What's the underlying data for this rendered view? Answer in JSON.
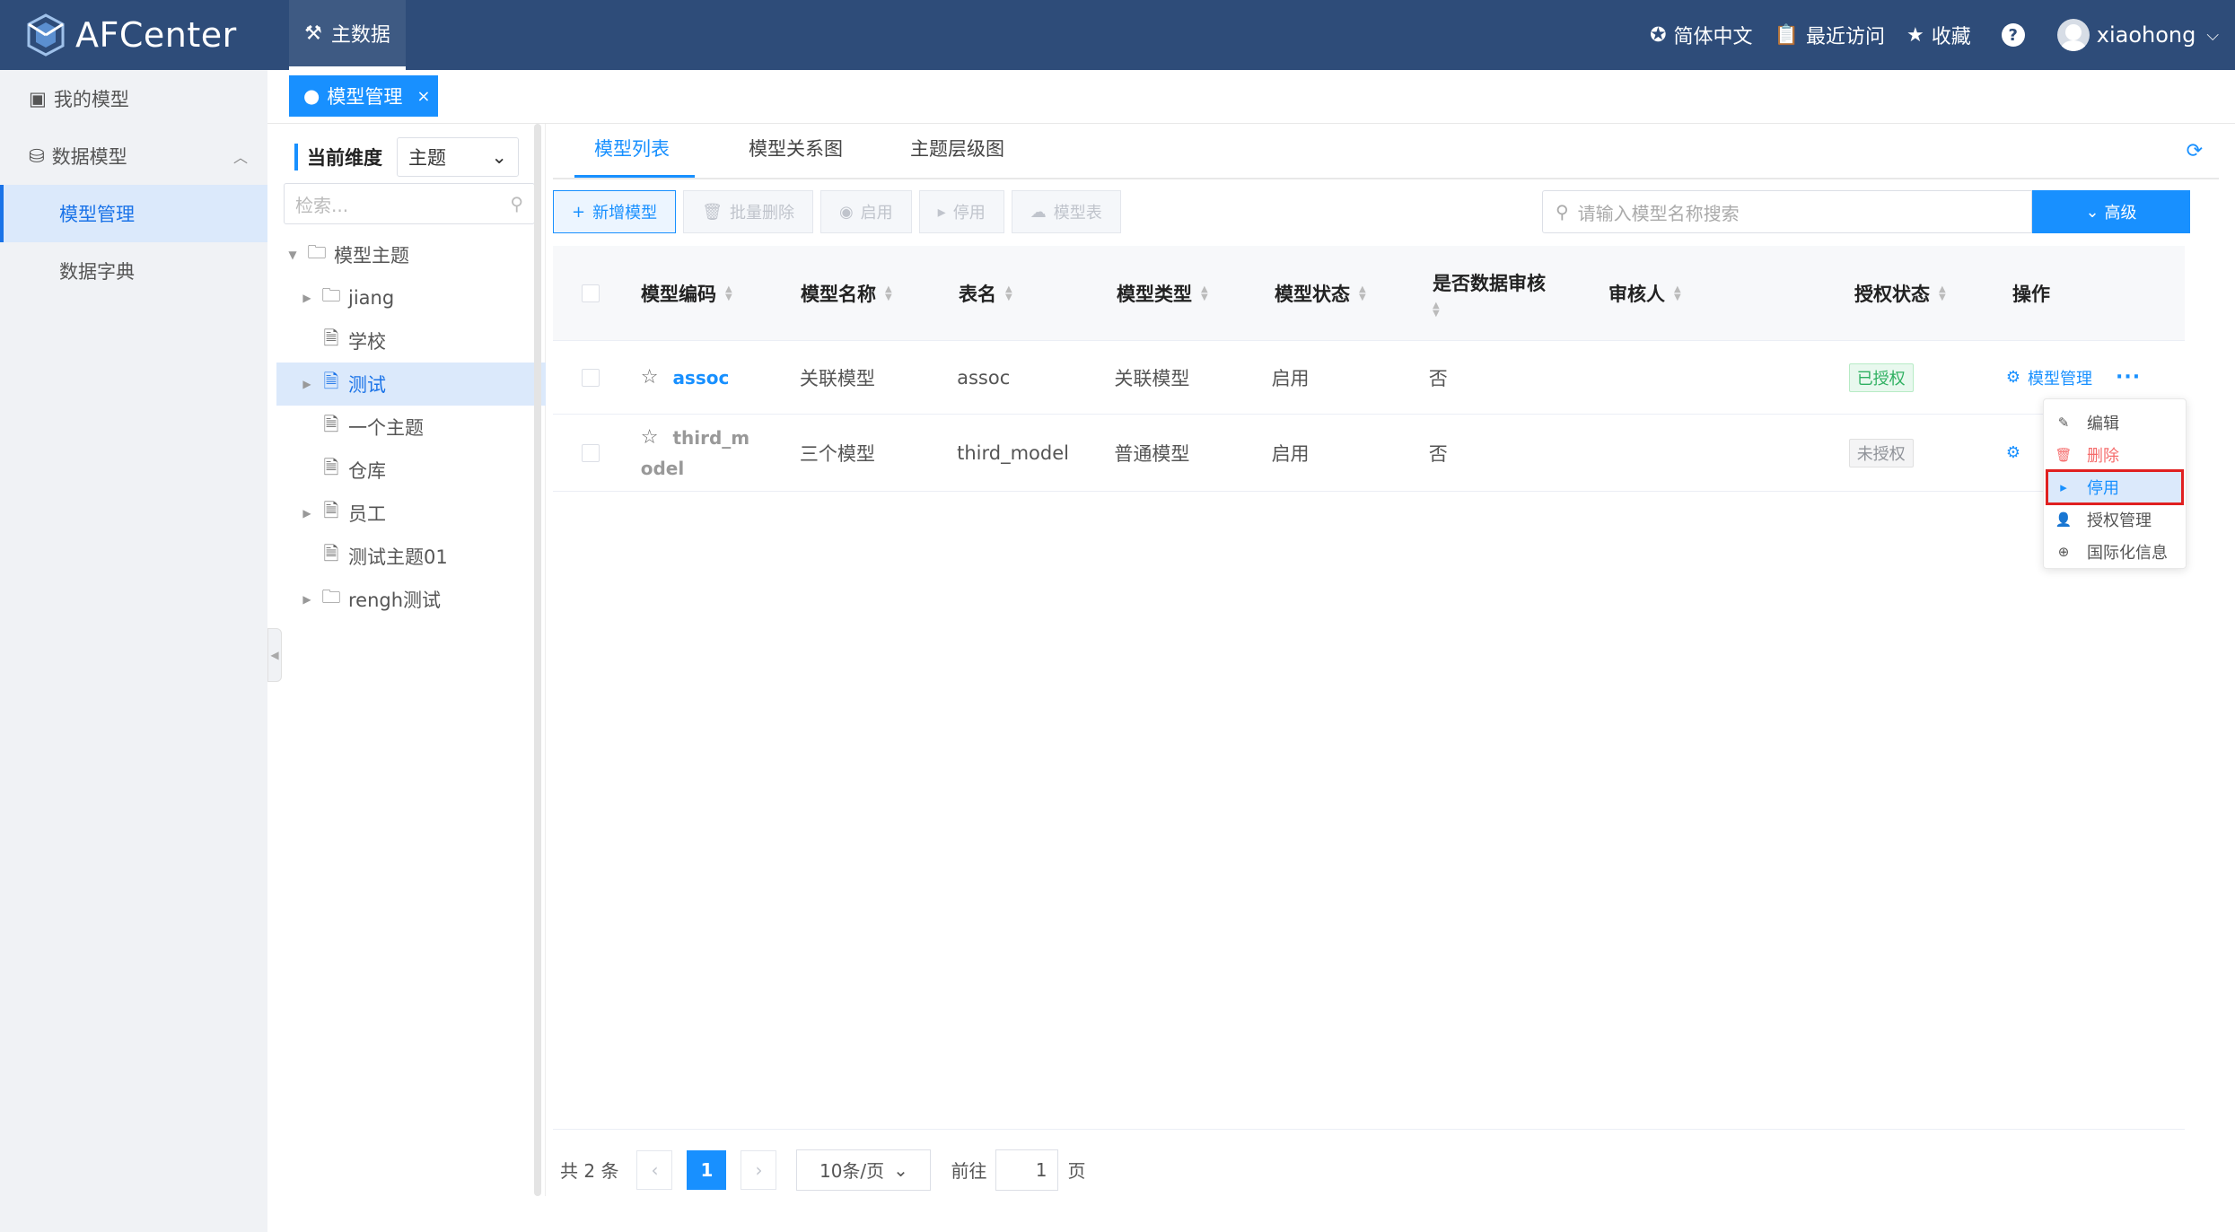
{
  "header": {
    "app_name": "AFCenter",
    "top_tab": "主数据",
    "language": "简体中文",
    "recent": "最近访问",
    "favorites": "收藏",
    "help": "?",
    "username": "xiaohong"
  },
  "sidebar": {
    "my_models": "我的模型",
    "data_model": "数据模型",
    "items": [
      "模型管理",
      "数据字典"
    ]
  },
  "page_tab": {
    "label": "模型管理",
    "close": "×"
  },
  "tree_panel": {
    "dimension_label": "当前维度",
    "dimension_value": "主题",
    "search_placeholder": "检索...",
    "nodes": [
      "模型主题",
      "jiang",
      "学校",
      "测试",
      "一个主题",
      "仓库",
      "员工",
      "测试主题01",
      "rengh测试"
    ]
  },
  "main_tabs": [
    "模型列表",
    "模型关系图",
    "主题层级图"
  ],
  "toolbar": {
    "add": "新增模型",
    "batch_delete": "批量删除",
    "enable": "启用",
    "disable": "停用",
    "model_table": "模型表",
    "search_placeholder": "请输入模型名称搜索",
    "advanced": "高级"
  },
  "table": {
    "columns": [
      "模型编码",
      "模型名称",
      "表名",
      "模型类型",
      "模型状态",
      "是否数据审核",
      "审核人",
      "授权状态",
      "操作"
    ],
    "rows": [
      {
        "code": "assoc",
        "name": "关联模型",
        "table": "assoc",
        "type": "关联模型",
        "status": "启用",
        "audit": "否",
        "reviewer": "",
        "auth": "已授权",
        "op": "模型管理",
        "more": "···"
      },
      {
        "code": "third_m",
        "code2": "odel",
        "name": "三个模型",
        "table": "third_model",
        "type": "普通模型",
        "status": "启用",
        "audit": "否",
        "reviewer": "",
        "auth": "未授权"
      }
    ]
  },
  "dropdown": [
    "编辑",
    "删除",
    "停用",
    "授权管理",
    "国际化信息"
  ],
  "pager": {
    "total": "共 2 条",
    "current": "1",
    "page_size": "10条/页",
    "goto_prefix": "前往",
    "goto_value": "1",
    "goto_suffix": "页"
  },
  "colors": {
    "header": "#2e4c79",
    "primary": "#1890ff",
    "success": "#2fb061",
    "danger": "#f56c6c",
    "highlight_border": "#e02020"
  }
}
